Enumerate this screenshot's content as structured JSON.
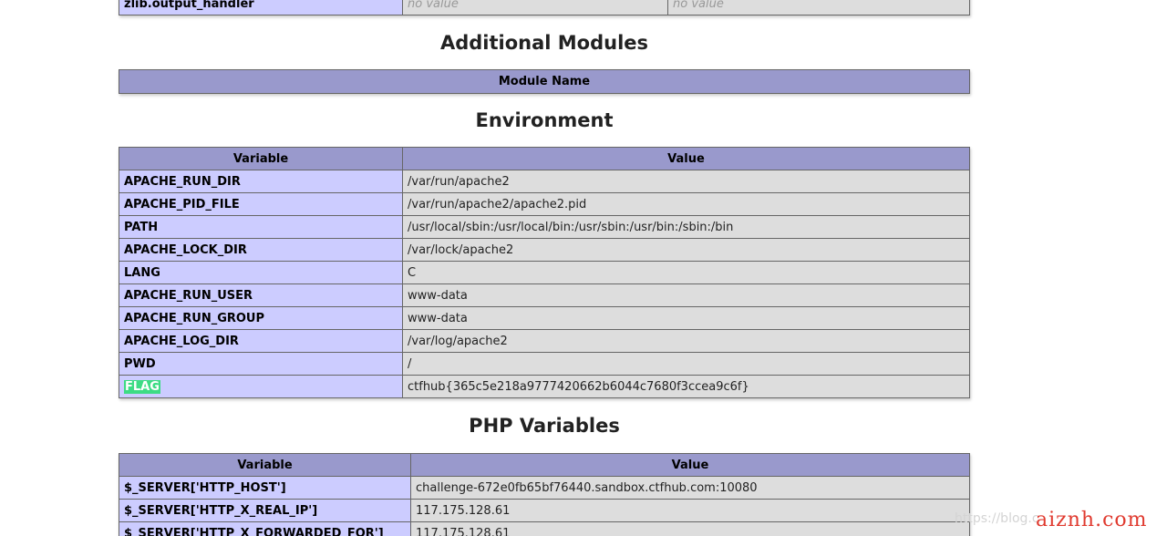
{
  "top_row": {
    "directive": "zlib.output_handler",
    "local_value": "no value",
    "master_value": "no value"
  },
  "additional_modules": {
    "heading": "Additional Modules",
    "column": "Module Name"
  },
  "environment": {
    "heading": "Environment",
    "columns": [
      "Variable",
      "Value"
    ],
    "rows": [
      {
        "name": "APACHE_RUN_DIR",
        "value": "/var/run/apache2"
      },
      {
        "name": "APACHE_PID_FILE",
        "value": "/var/run/apache2/apache2.pid"
      },
      {
        "name": "PATH",
        "value": "/usr/local/sbin:/usr/local/bin:/usr/sbin:/usr/bin:/sbin:/bin"
      },
      {
        "name": "APACHE_LOCK_DIR",
        "value": "/var/lock/apache2"
      },
      {
        "name": "LANG",
        "value": "C"
      },
      {
        "name": "APACHE_RUN_USER",
        "value": "www-data"
      },
      {
        "name": "APACHE_RUN_GROUP",
        "value": "www-data"
      },
      {
        "name": "APACHE_LOG_DIR",
        "value": "/var/log/apache2"
      },
      {
        "name": "PWD",
        "value": "/"
      },
      {
        "name": "FLAG",
        "value": "ctfhub{365c5e218a9777420662b6044c7680f3ccea9c6f}"
      }
    ]
  },
  "php_variables": {
    "heading": "PHP Variables",
    "columns": [
      "Variable",
      "Value"
    ],
    "rows": [
      {
        "name": "$_SERVER['HTTP_HOST']",
        "value": "challenge-672e0fb65bf76440.sandbox.ctfhub.com:10080"
      },
      {
        "name": "$_SERVER['HTTP_X_REAL_IP']",
        "value": "117.175.128.61"
      },
      {
        "name": "$_SERVER['HTTP_X_FORWARDED_FOR']",
        "value": "117.175.128.61"
      }
    ]
  },
  "watermark": {
    "url": "https://blog.c",
    "brand": "aiznh.com"
  },
  "colors": {
    "header_bg": "#9999cc",
    "key_bg": "#ccccff",
    "value_bg": "#dddddd",
    "flag_highlight": "#3ddc84",
    "watermark_brand": "#e03a2f"
  }
}
